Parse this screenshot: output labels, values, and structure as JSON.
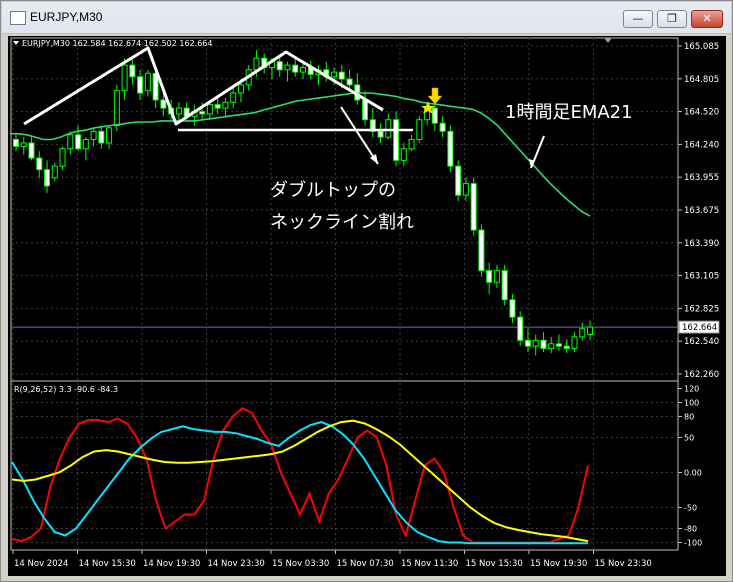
{
  "window": {
    "title": "EURJPY,M30"
  },
  "chart_data": [
    {
      "type": "candlestick",
      "label": "EURJPY,M30  162.584 162.674 162.502 162.664",
      "price_axis_ticks": [
        "165.085",
        "164.805",
        "164.520",
        "164.240",
        "163.955",
        "163.675",
        "163.390",
        "163.105",
        "162.825",
        "162.540",
        "162.260"
      ],
      "price_range": [
        162.26,
        165.085
      ],
      "current_price": "162.664",
      "annotations": {
        "ema_label": "1時間足EMA21",
        "pattern_line1": "ダブルトップの",
        "pattern_line2": "ネックライン割れ"
      },
      "ohlc": [
        [
          164.28,
          164.33,
          164.18,
          164.22
        ],
        [
          164.22,
          164.3,
          164.15,
          164.25
        ],
        [
          164.25,
          164.3,
          164.1,
          164.12
        ],
        [
          164.12,
          164.18,
          163.95,
          164.02
        ],
        [
          164.02,
          164.1,
          163.82,
          163.88
        ],
        [
          163.95,
          164.08,
          163.92,
          164.05
        ],
        [
          164.05,
          164.22,
          164.02,
          164.2
        ],
        [
          164.2,
          164.35,
          164.15,
          164.32
        ],
        [
          164.32,
          164.4,
          164.18,
          164.2
        ],
        [
          164.2,
          164.3,
          164.1,
          164.28
        ],
        [
          164.28,
          164.38,
          164.22,
          164.35
        ],
        [
          164.35,
          164.4,
          164.2,
          164.25
        ],
        [
          164.25,
          164.4,
          164.2,
          164.38
        ],
        [
          164.4,
          164.75,
          164.35,
          164.7
        ],
        [
          164.7,
          164.98,
          164.62,
          164.92
        ],
        [
          164.92,
          165.0,
          164.75,
          164.82
        ],
        [
          164.82,
          164.88,
          164.62,
          164.68
        ],
        [
          164.7,
          164.88,
          164.65,
          164.85
        ],
        [
          164.85,
          164.9,
          164.55,
          164.62
        ],
        [
          164.62,
          164.7,
          164.48,
          164.55
        ],
        [
          164.55,
          164.62,
          164.45,
          164.5
        ],
        [
          164.5,
          164.6,
          164.42,
          164.55
        ],
        [
          164.55,
          164.6,
          164.45,
          164.48
        ],
        [
          164.48,
          164.58,
          164.4,
          164.52
        ],
        [
          164.52,
          164.6,
          164.45,
          164.5
        ],
        [
          164.5,
          164.62,
          164.45,
          164.58
        ],
        [
          164.58,
          164.66,
          164.5,
          164.55
        ],
        [
          164.55,
          164.64,
          164.48,
          164.6
        ],
        [
          164.6,
          164.72,
          164.55,
          164.68
        ],
        [
          164.68,
          164.8,
          164.6,
          164.75
        ],
        [
          164.75,
          164.92,
          164.7,
          164.88
        ],
        [
          164.88,
          165.05,
          164.82,
          164.98
        ],
        [
          164.98,
          165.02,
          164.85,
          164.9
        ],
        [
          164.9,
          164.98,
          164.8,
          164.95
        ],
        [
          164.95,
          165.0,
          164.82,
          164.88
        ],
        [
          164.88,
          164.95,
          164.78,
          164.92
        ],
        [
          164.92,
          164.98,
          164.82,
          164.86
        ],
        [
          164.86,
          164.96,
          164.8,
          164.9
        ],
        [
          164.9,
          164.96,
          164.8,
          164.84
        ],
        [
          164.84,
          164.92,
          164.75,
          164.88
        ],
        [
          164.88,
          164.95,
          164.78,
          164.82
        ],
        [
          164.82,
          164.9,
          164.75,
          164.86
        ],
        [
          164.86,
          164.92,
          164.72,
          164.8
        ],
        [
          164.8,
          164.88,
          164.7,
          164.75
        ],
        [
          164.75,
          164.85,
          164.58,
          164.62
        ],
        [
          164.62,
          164.7,
          164.4,
          164.45
        ],
        [
          164.45,
          164.55,
          164.3,
          164.35
        ],
        [
          164.35,
          164.42,
          164.25,
          164.3
        ],
        [
          164.3,
          164.5,
          164.28,
          164.45
        ],
        [
          164.45,
          164.52,
          164.05,
          164.1
        ],
        [
          164.1,
          164.25,
          164.05,
          164.2
        ],
        [
          164.2,
          164.32,
          164.18,
          164.28
        ],
        [
          164.28,
          164.48,
          164.25,
          164.45
        ],
        [
          164.45,
          164.6,
          164.4,
          164.55
        ],
        [
          164.55,
          164.58,
          164.35,
          164.42
        ],
        [
          164.42,
          164.48,
          164.3,
          164.35
        ],
        [
          164.35,
          164.4,
          164.0,
          164.05
        ],
        [
          164.05,
          164.1,
          163.75,
          163.8
        ],
        [
          163.8,
          163.95,
          163.75,
          163.9
        ],
        [
          163.9,
          163.95,
          163.45,
          163.5
        ],
        [
          163.5,
          163.55,
          163.1,
          163.15
        ],
        [
          163.15,
          163.22,
          162.95,
          163.05
        ],
        [
          163.05,
          163.2,
          163.0,
          163.15
        ],
        [
          163.15,
          163.2,
          162.85,
          162.9
        ],
        [
          162.9,
          162.95,
          162.7,
          162.75
        ],
        [
          162.75,
          162.8,
          162.5,
          162.55
        ],
        [
          162.55,
          162.65,
          162.45,
          162.5
        ],
        [
          162.5,
          162.6,
          162.42,
          162.55
        ],
        [
          162.55,
          162.62,
          162.45,
          162.48
        ],
        [
          162.48,
          162.58,
          162.44,
          162.52
        ],
        [
          162.52,
          162.6,
          162.46,
          162.5
        ],
        [
          162.5,
          162.56,
          162.44,
          162.48
        ],
        [
          162.48,
          162.62,
          162.45,
          162.58
        ],
        [
          162.58,
          162.7,
          162.55,
          162.65
        ],
        [
          162.6,
          162.72,
          162.55,
          162.664
        ]
      ],
      "ema": [
        164.33,
        164.33,
        164.32,
        164.3,
        164.28,
        164.28,
        164.3,
        164.33,
        164.35,
        164.36,
        164.38,
        164.39,
        164.4,
        164.41,
        164.42,
        164.43,
        164.43,
        164.43,
        164.44,
        164.44,
        164.44,
        164.44,
        164.44,
        164.45,
        164.46,
        164.47,
        164.48,
        164.49,
        164.5,
        164.51,
        164.53,
        164.55,
        164.57,
        164.59,
        164.61,
        164.62,
        164.63,
        164.64,
        164.65,
        164.66,
        164.67,
        164.68,
        164.68,
        164.68,
        164.67,
        164.66,
        164.65,
        164.63,
        164.62,
        164.6,
        164.59,
        164.58,
        164.57,
        164.56,
        164.55,
        164.54,
        164.51,
        164.46,
        164.4,
        164.32,
        164.24,
        164.16,
        164.08,
        164.0,
        163.92,
        163.85,
        163.78,
        163.72,
        163.66,
        163.62
      ],
      "ema_start_index": 0
    },
    {
      "type": "line",
      "label": "R(9,26,52) 3.3 -90.6 -84.3",
      "y_axis_ticks": [
        "120",
        "100",
        "80",
        "50",
        "0.00",
        "-50",
        "-80",
        "-100"
      ],
      "ylim": [
        -105,
        125
      ],
      "x_axis_ticks": [
        "14 Nov 2024",
        "14 Nov 15:30",
        "14 Nov 19:30",
        "14 Nov 23:30",
        "15 Nov 03:30",
        "15 Nov 07:30",
        "15 Nov 11:30",
        "15 Nov 15:30",
        "15 Nov 19:30",
        "15 Nov 23:30"
      ],
      "series": [
        {
          "color": "#ff0000",
          "values": [
            -95,
            -98,
            -92,
            -80,
            -20,
            20,
            50,
            70,
            75,
            75,
            72,
            77,
            70,
            50,
            20,
            -40,
            -80,
            -70,
            -60,
            -60,
            -40,
            20,
            60,
            80,
            92,
            85,
            60,
            40,
            0,
            -30,
            -60,
            -30,
            -70,
            -30,
            -10,
            20,
            50,
            60,
            50,
            10,
            -60,
            -90,
            -40,
            10,
            20,
            0,
            -50,
            -90,
            -100,
            -100,
            -100,
            -100,
            -100,
            -100,
            -100,
            -100,
            -100,
            -95,
            -90,
            -50,
            10
          ]
        },
        {
          "color": "#00e5ff",
          "values": [
            15,
            -10,
            -40,
            -65,
            -85,
            -90,
            -80,
            -60,
            -40,
            -20,
            0,
            20,
            35,
            48,
            58,
            62,
            66,
            62,
            60,
            58,
            58,
            56,
            52,
            48,
            42,
            38,
            50,
            60,
            68,
            72,
            66,
            55,
            40,
            20,
            -5,
            -30,
            -55,
            -72,
            -85,
            -92,
            -98,
            -100,
            -100,
            -101,
            -101,
            -101,
            -101,
            -101,
            -101,
            -101,
            -101,
            -101,
            -101,
            -101,
            -101
          ]
        },
        {
          "color": "#ffff00",
          "values": [
            -10,
            -12,
            -10,
            -5,
            0,
            10,
            22,
            30,
            32,
            30,
            26,
            22,
            18,
            15,
            14,
            14,
            15,
            16,
            18,
            20,
            22,
            24,
            26,
            30,
            38,
            48,
            58,
            66,
            72,
            74,
            70,
            62,
            52,
            40,
            25,
            10,
            -5,
            -20,
            -35,
            -50,
            -62,
            -72,
            -78,
            -82,
            -85,
            -88,
            -90,
            -92,
            -95,
            -98
          ]
        }
      ]
    }
  ]
}
